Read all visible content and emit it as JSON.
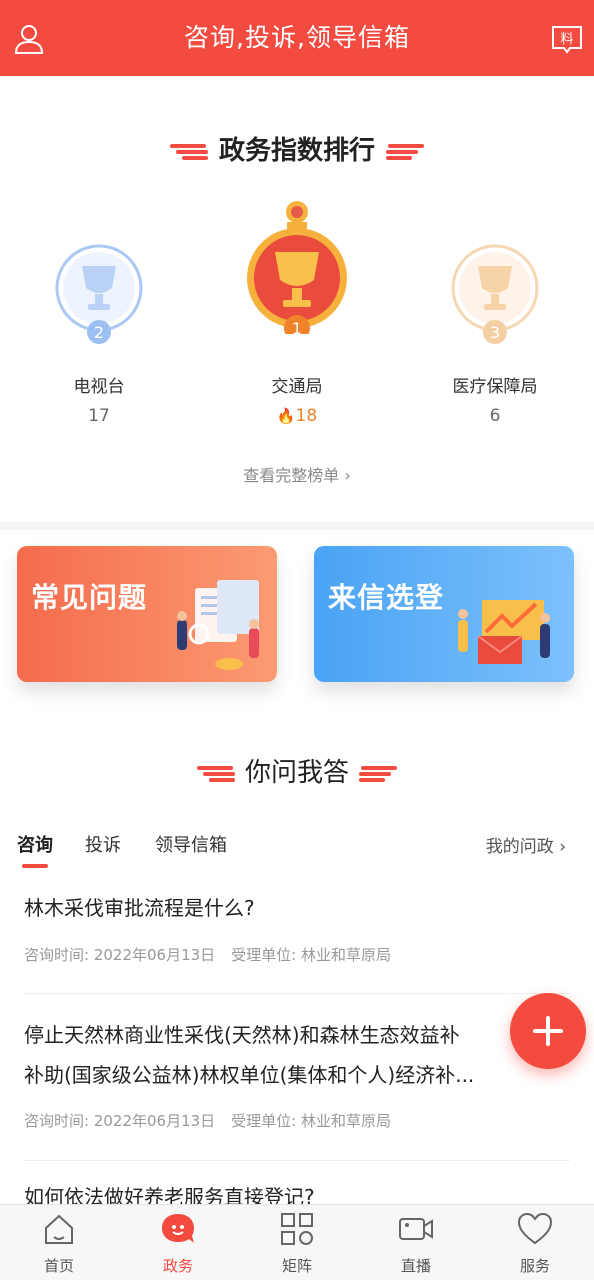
{
  "header": {
    "title": "咨询,投诉,领导信箱",
    "user_icon": "user-icon",
    "news_icon": "news-material-icon",
    "news_badge": "料",
    "color": "#f44b40"
  },
  "ranking": {
    "title": "政务指数排行",
    "items": [
      {
        "rank": "2",
        "name": "电视台",
        "score": "17",
        "color": "#8fb8ef"
      },
      {
        "rank": "1",
        "name": "交通局",
        "score": "18",
        "color": "#f0822a",
        "hot": true
      },
      {
        "rank": "3",
        "name": "医疗保障局",
        "score": "6",
        "color": "#f5cfa4"
      }
    ],
    "view_all": "查看完整榜单"
  },
  "banners": {
    "faq": "常见问题",
    "letters": "来信选登"
  },
  "qa": {
    "title": "你问我答",
    "tabs": [
      "咨询",
      "投诉",
      "领导信箱"
    ],
    "active_tab": "咨询",
    "my_questions": "我的问政",
    "questions": [
      {
        "title": "林木采伐审批流程是什么?",
        "time_label": "咨询时间: 2022年06月13日",
        "dept_label": "受理单位: 林业和草原局"
      },
      {
        "title_line1": "停止天然林商业性采伐(天然林)和森林生态效益补",
        "title_line2": "补助(国家级公益林)林权单位(集体和个人)经济补...",
        "time_label": "咨询时间: 2022年06月13日",
        "dept_label": "受理单位: 林业和草原局"
      },
      {
        "title": "如何依法做好养老服务直接登记?"
      }
    ]
  },
  "fab": {
    "icon": "plus-icon"
  },
  "bottom_nav": [
    {
      "label": "首页",
      "icon": "home-icon"
    },
    {
      "label": "政务",
      "icon": "chat-bubble-icon",
      "active": true
    },
    {
      "label": "矩阵",
      "icon": "grid-icon"
    },
    {
      "label": "直播",
      "icon": "video-camera-icon"
    },
    {
      "label": "服务",
      "icon": "heart-icon"
    }
  ]
}
